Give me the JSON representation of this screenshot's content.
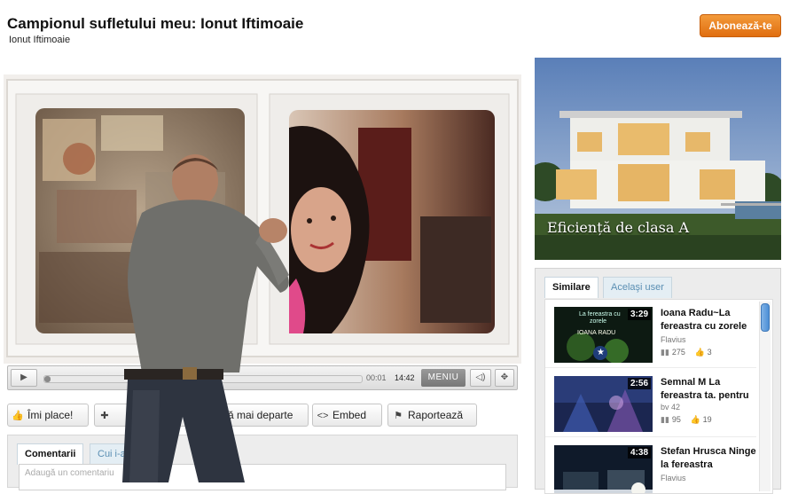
{
  "header": {
    "title": "Campionul sufletului meu: Ionut Iftimoaie",
    "channel": "Ionut Iftimoaie",
    "subscribe_label": "Abonează-te"
  },
  "player": {
    "current_time": "00:01",
    "total_time": "14:42",
    "menu_label": "MENIU",
    "progress": 0.02
  },
  "actions": {
    "like_label": "Îmi place!",
    "share_label": "ă mai departe",
    "embed_label": "Embed",
    "report_label": "Raportează"
  },
  "comments": {
    "tabs": [
      {
        "label": "Comentarii",
        "active": true
      },
      {
        "label": "Cui i-a"
      }
    ],
    "input_placeholder": "Adaugă un comentariu"
  },
  "ad": {
    "caption": "Eficiență de clasa A"
  },
  "related": {
    "tabs": [
      {
        "label": "Similare",
        "active": true
      },
      {
        "label": "Acelaşi user"
      }
    ],
    "items": [
      {
        "title": "Ioana Radu~La fereastra cu zorele",
        "author": "Flavius",
        "duration": "3:29",
        "views": "275",
        "likes": "3",
        "thumb_text_1": "La fereastra cu",
        "thumb_text_2": "zorele",
        "thumb_text_3": "IOANA RADU"
      },
      {
        "title": "Semnal M La fereastra ta. pentru",
        "author": "bv 42",
        "duration": "2:56",
        "views": "95",
        "likes": "19"
      },
      {
        "title": "Stefan Hrusca Ninge la fereastra",
        "author": "Flavius",
        "duration": "4:38",
        "views": "",
        "likes": ""
      }
    ]
  },
  "colors": {
    "subscribe": "#e97c1c",
    "scroll_thumb": "#4d8fd6",
    "tab_border": "#c8d6df"
  }
}
